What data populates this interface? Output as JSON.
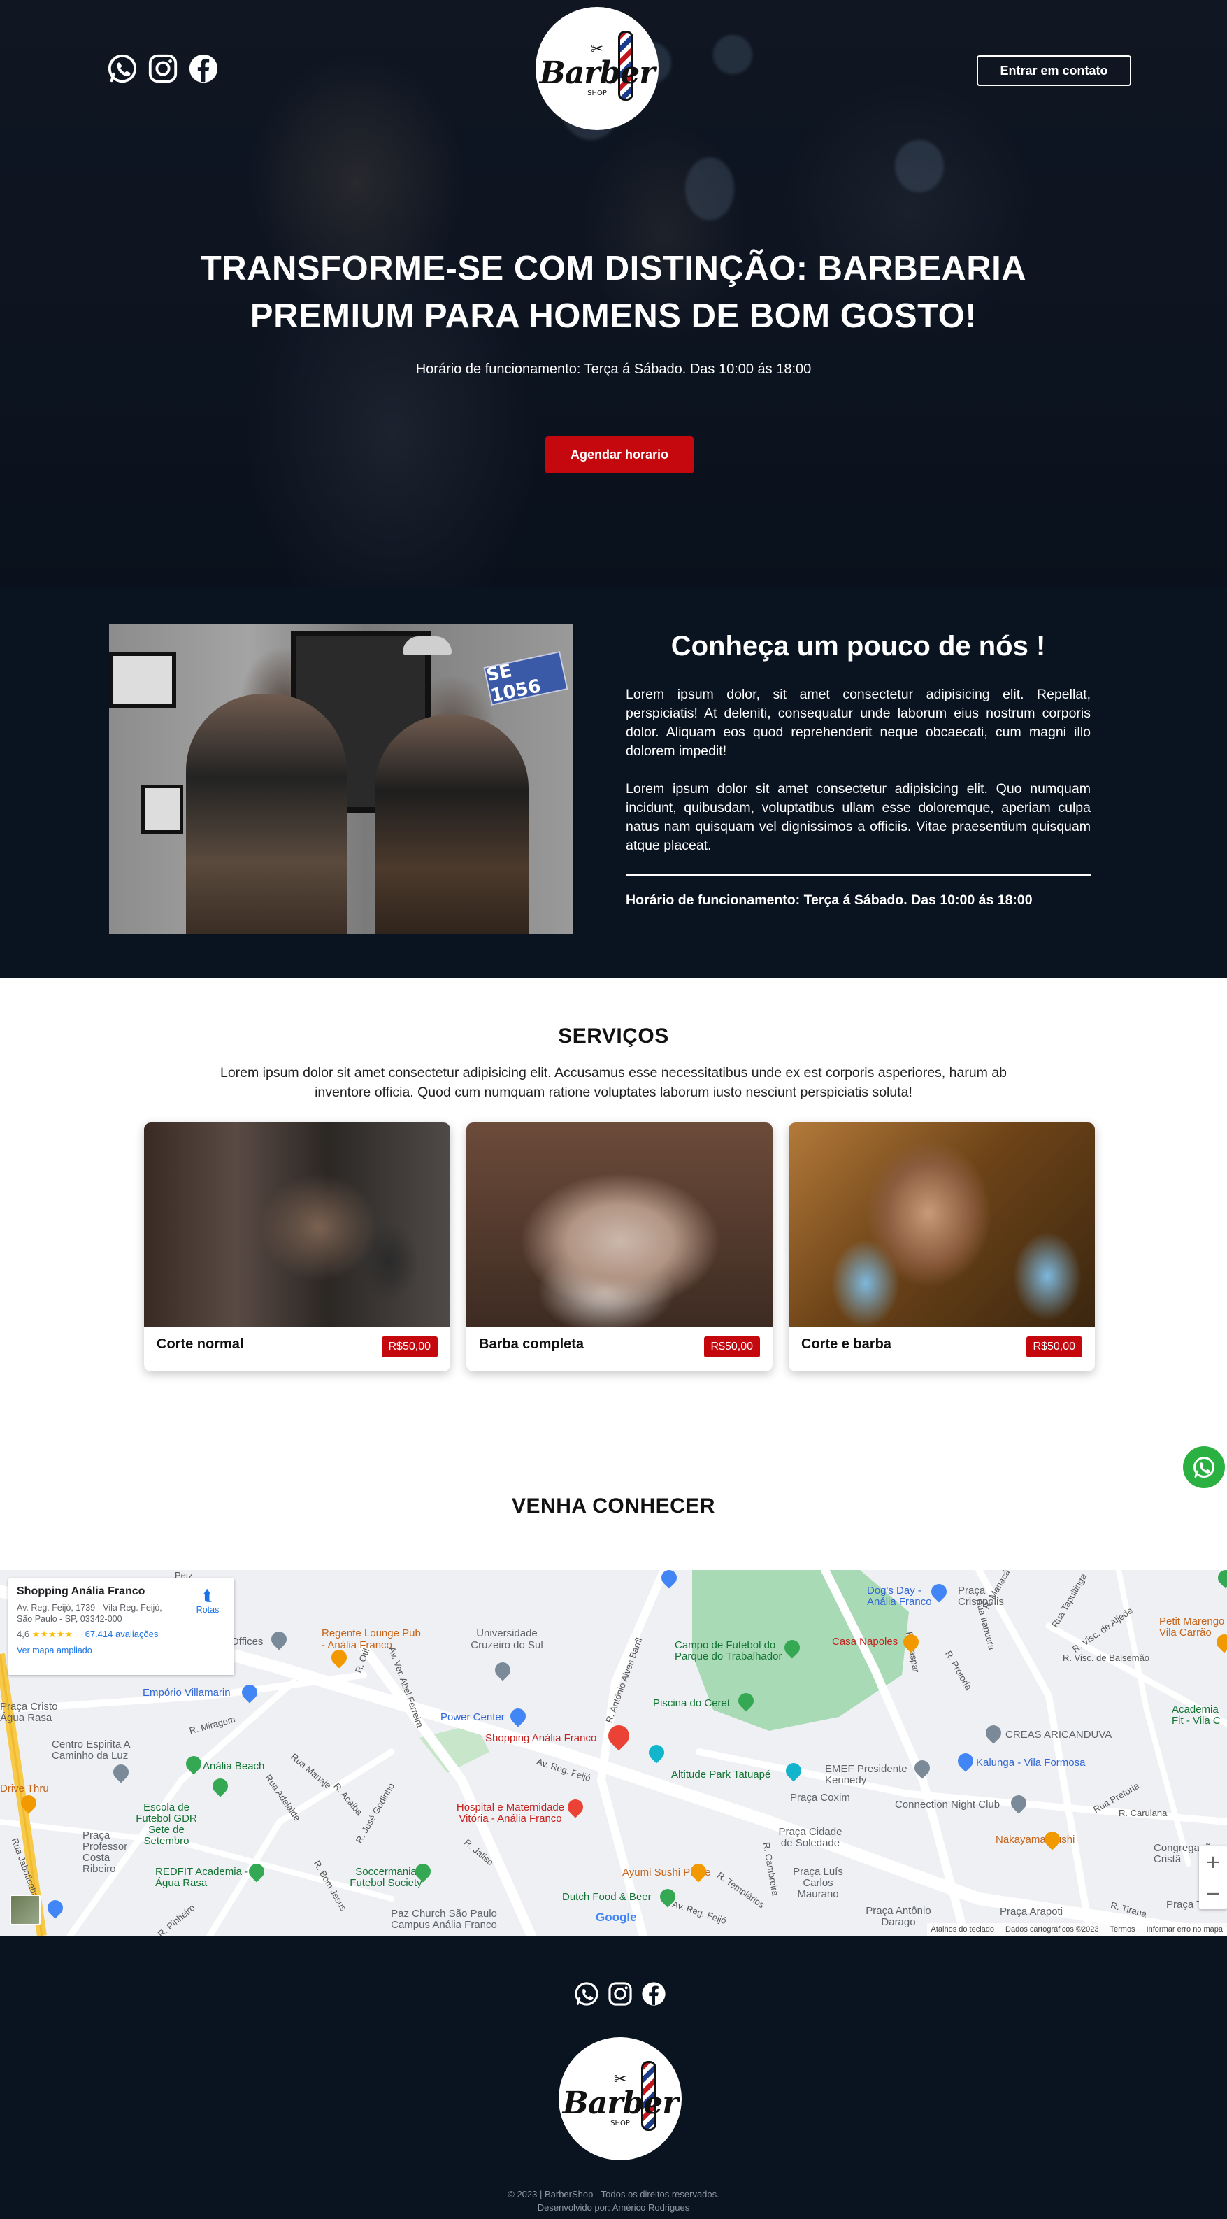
{
  "header": {
    "social_icons": [
      "whatsapp-icon",
      "instagram-icon",
      "facebook-icon"
    ],
    "logo_text": "Barber",
    "logo_small": "SHOP",
    "contact_button": "Entrar em contato"
  },
  "hero": {
    "title": "TRANSFORME-SE COM DISTINÇÃO: BARBEARIA PREMIUM PARA HOMENS DE BOM GOSTO!",
    "hours": "Horário de funcionamento: Terça á Sábado. Das 10:00 ás 18:00",
    "cta": "Agendar horario"
  },
  "about": {
    "plate_text": "SE 1056",
    "title": "Conheça um pouco de nós !",
    "paragraph_1": "Lorem ipsum dolor, sit amet consectetur adipisicing elit. Repellat, perspiciatis! At deleniti, consequatur unde laborum eius nostrum corporis dolor. Aliquam eos quod reprehenderit neque obcaecati, cum magni illo dolorem impedit!",
    "paragraph_2": "Lorem ipsum dolor sit amet consectetur adipisicing elit. Quo numquam incidunt, quibusdam, voluptatibus ullam esse doloremque, aperiam culpa natus nam quisquam vel dignissimos a officiis. Vitae praesentium quisquam atque placeat.",
    "hours": "Horário de funcionamento: Terça á Sábado. Das 10:00 ás 18:00"
  },
  "services": {
    "title": "SERVIÇOS",
    "description": "Lorem ipsum dolor sit amet consectetur adipisicing elit. Accusamus esse necessitatibus unde ex est corporis asperiores, harum ab inventore officia. Quod cum numquam ratione voluptates laborum iusto nesciunt perspiciatis soluta!",
    "items": [
      {
        "name": "Corte normal",
        "price": "R$50,00"
      },
      {
        "name": "Barba completa",
        "price": "R$50,00"
      },
      {
        "name": "Corte e barba",
        "price": "R$50,00"
      }
    ]
  },
  "visit": {
    "title": "VENHA CONHECER"
  },
  "map": {
    "place_name": "Shopping Anália Franco",
    "address": "Av. Reg. Feijó, 1739 - Vila Reg. Feijó, São Paulo - SP, 03342-000",
    "rating": "4,6",
    "stars": "★★★★★",
    "reviews": "67.414 avaliações",
    "view_larger": "Ver mapa ampliado",
    "route_label": "Rotas",
    "zoom_in": "+",
    "zoom_out": "−",
    "google": "Google",
    "attribution": [
      "Atalhos do teclado",
      "Dados cartográficos ©2023",
      "Termos",
      "Informar erro no mapa"
    ],
    "labels": {
      "regente": "Regente Lounge Pub - Anália Franco",
      "universidade": "Universidade Cruzeiro do Sul",
      "campo": "Campo de Futebol do Parque do Trabalhador",
      "dogs": "Dog's Day - Anália Franco",
      "crisopolis": "Praça Crisopolis",
      "casa_napoles": "Casa Napoles",
      "petit": "Petit Marengo Vila Carrão",
      "emporio": "Empório Villamarin",
      "power": "Power Center",
      "shopping_pin": "Shopping Anália Franco",
      "piscina": "Piscina do Ceret",
      "altitude": "Altitude Park Tatuapé",
      "emef": "EMEF Presidente Kennedy",
      "creas": "CREAS ARICANDUVA",
      "academia_fit": "Academia Fit - Vila C",
      "kalunga": "Kalunga - Vila Formosa",
      "analia_beach": "Anália Beach",
      "escola": "Escola de Futebol GDR Sete de Setembro",
      "hospital": "Hospital e Maternidade Vitória - Anália Franco",
      "connection": "Connection Night Club",
      "nakayama": "Nakayama Sushi",
      "centro_espirita": "Centro Espirita A Caminho da Luz",
      "praca_cristo": "Praça Cristo Água Rasa",
      "praca_professor": "Praça Professor Costa Ribeiro",
      "redfit": "REDFIT Academia - Água Rasa",
      "soccermania": "Soccermania Futebol Society",
      "ayumi": "Ayumi Sushi Prime",
      "dutch": "Dutch Food & Beer",
      "paz_church": "Paz Church São Paulo Campus Anália Franco",
      "praca_cidade": "Praça Cidade de Soledade",
      "praca_coxim": "Praça Coxim",
      "praca_luis": "Praça Luís Carlos Maurano",
      "praca_antonio": "Praça Antônio Darago",
      "praca_arapoti": "Praça Arapoti",
      "congregacao": "Congregação Cristã",
      "praca_tadash": "Praça Tadash",
      "drive_thru": "Drive Thru",
      "petz": "Petz",
      "offices": "Offices",
      "av_reg_feijo": "Av. Reg. Feijó",
      "r_antonio_alves_barril": "R. Antônio Alves Barril",
      "av_ver_abel_ferreira": "Av. Ver. Abel Ferreira",
      "r_miragem": "R. Miragem",
      "r_jose_godinho": "R. José Godinho",
      "rua_manage": "Rua Manaje",
      "r_acaiba": "R. Acaiba",
      "rua_adelaide": "Rua Adelaide",
      "r_juliano": "R. Jaliso",
      "r_bom_jesus": "R. Bom Jesus",
      "r_templarios": "R. Templários",
      "r_cambreira": "R. Cambreira",
      "r_tirana": "R. Tirana",
      "r_pretoria": "R. Pretoria",
      "r_gaspar": "R. Gaspar",
      "rua_itapuera": "Rua Itapuera",
      "r_visc_de_balsemao": "R. Visc. de Balsemão",
      "r_carulana": "R. Carulana",
      "r_visc_de_aljede": "R. Visc. de Aljede",
      "rua_tapuitinga": "Rua Tapuitinga",
      "r_manaca": "R. Manacá",
      "rua_jaboticabal": "Rua Jaboticabal",
      "r_pedro_maia": "R. Pinheiro",
      "r_otil": "R. Otil",
      "rua_tapuitinga2": "Rua Pretoria"
    }
  },
  "footer": {
    "social_icons": [
      "whatsapp-icon",
      "instagram-icon",
      "facebook-icon"
    ],
    "copyright": "© 2023 | BarberShop - Todos os direitos reservados.",
    "credits": "Desenvolvido por: Américo Rodrigues"
  }
}
